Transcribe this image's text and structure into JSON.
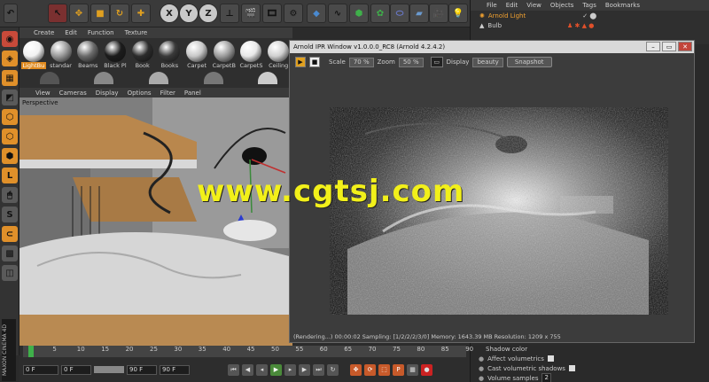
{
  "app": {
    "name": "Cinema 4D",
    "brand": "MAXON",
    "product": "CINEMA 4D"
  },
  "material_manager": {
    "menu": [
      "Create",
      "Edit",
      "Function",
      "Texture"
    ],
    "materials": [
      {
        "label": "LightBu",
        "color": "#f2f2f2",
        "selected": true
      },
      {
        "label": "standar",
        "color": "#9a9a9a"
      },
      {
        "label": "Beams",
        "color": "#6b6b6b"
      },
      {
        "label": "Black Pl",
        "color": "#1c1c1c"
      },
      {
        "label": "Book",
        "color": "#2c2c2c"
      },
      {
        "label": "Books",
        "color": "#3a3a3a"
      },
      {
        "label": "Carpet",
        "color": "#c8c8c8"
      },
      {
        "label": "CarpetB",
        "color": "#9d9d9d"
      },
      {
        "label": "CarpetS",
        "color": "#e8e8e8"
      },
      {
        "label": "Ceiling",
        "color": "#d0d0d0"
      }
    ]
  },
  "viewport": {
    "menu": [
      "View",
      "Cameras",
      "Display",
      "Options",
      "Filter",
      "Panel"
    ],
    "label": "Perspective"
  },
  "object_manager": {
    "menu": [
      "File",
      "Edit",
      "View",
      "Objects",
      "Tags",
      "Bookmarks"
    ],
    "objects": [
      {
        "label": "Arnold Light",
        "selected": true
      },
      {
        "label": "Bulb",
        "selected": false
      }
    ]
  },
  "attributes": {
    "shadow_color": "Shadow color",
    "affect_volumetrics": "Affect volumetrics",
    "cast_volumetric_shadows": "Cast volumetric shadows",
    "volume_samples": "Volume samples",
    "volume_samples_value": "2"
  },
  "ipr": {
    "title": "Arnold IPR Window v1.0.0.0_RC8 (Arnold 4.2.4.2)",
    "scale_label": "Scale",
    "scale_value": "70 %",
    "zoom_label": "Zoom",
    "zoom_value": "50 %",
    "display_label": "Display",
    "display_value": "beauty",
    "snapshot_label": "Snapshot",
    "status": "(Rendering...)  00:00:02  Sampling: [1/2/2/2/3/0]  Memory: 1643.39 MB  Resolution: 1209 x 755"
  },
  "timeline": {
    "ticks": [
      "0",
      "5",
      "10",
      "15",
      "20",
      "25",
      "30",
      "35",
      "40",
      "45",
      "50",
      "55",
      "60",
      "65",
      "70",
      "75",
      "80",
      "85",
      "90"
    ],
    "start_field": "0 F",
    "min_field": "0 F",
    "max_field": "90 F",
    "end_field": "90 F",
    "current_field": "0 F"
  },
  "watermark": "www.cgtsj.com",
  "colors": {
    "accent_orange": "#e08a1e",
    "watermark_yellow": "#f2f01a",
    "play_green": "#4a8a3a"
  }
}
